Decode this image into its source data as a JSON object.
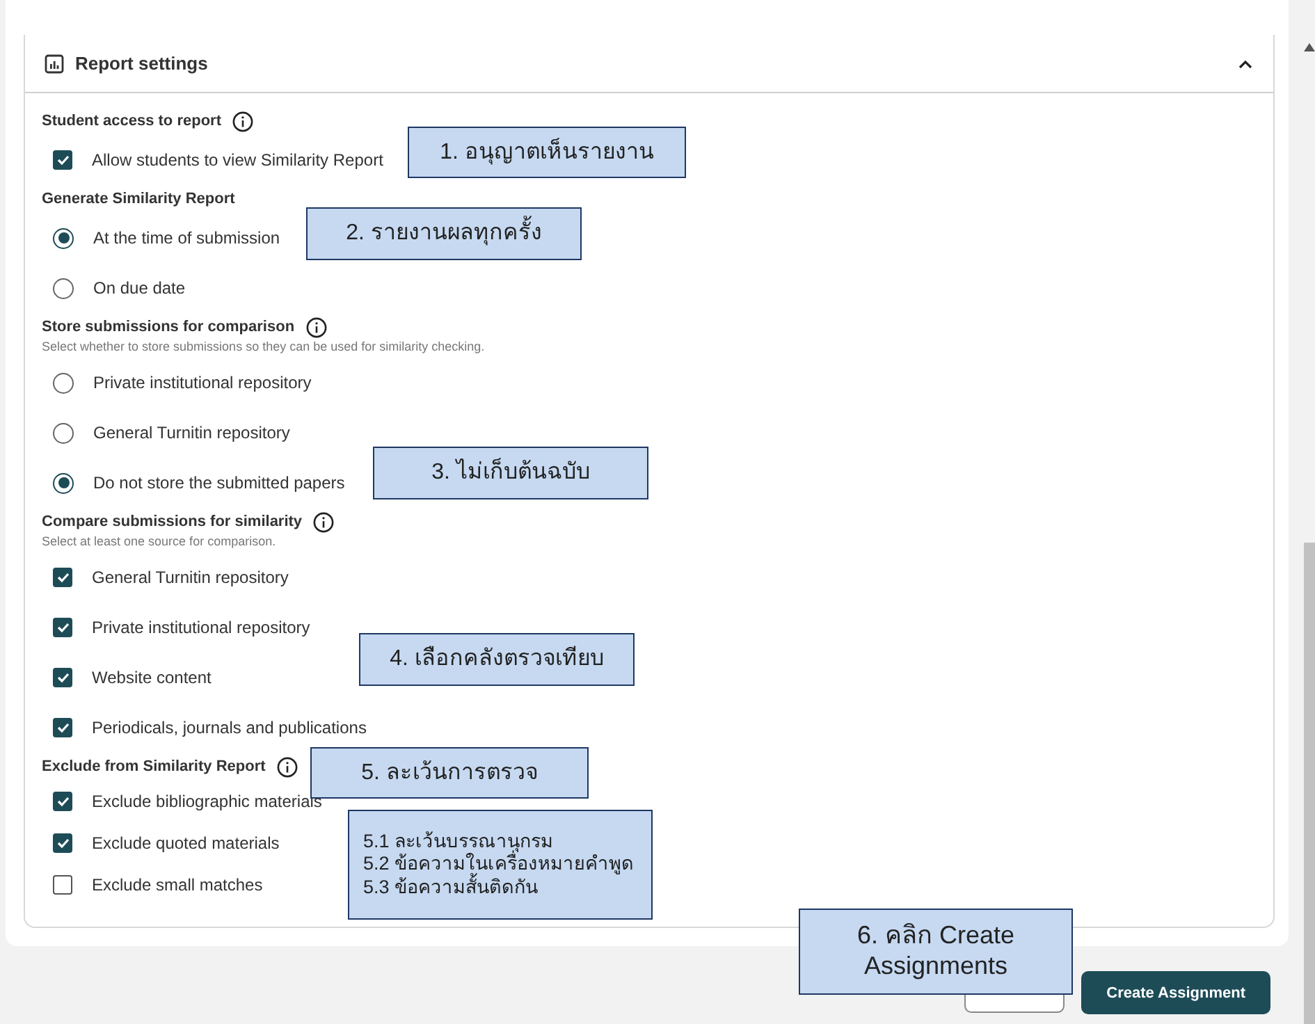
{
  "panel": {
    "title": "Report settings",
    "expanded": true
  },
  "sections": [
    {
      "title": "Student access to report",
      "info": true,
      "options": [
        {
          "kind": "checkbox",
          "label": "Allow students to view Similarity Report",
          "checked": true
        }
      ]
    },
    {
      "title": "Generate Similarity Report",
      "info": false,
      "options": [
        {
          "kind": "radio",
          "label": "At the time of submission",
          "selected": true
        },
        {
          "kind": "radio",
          "label": "On due date",
          "selected": false
        }
      ]
    },
    {
      "title": "Store submissions for comparison",
      "info": true,
      "hint": "Select whether to store submissions so they can be used for similarity checking.",
      "options": [
        {
          "kind": "radio",
          "label": "Private institutional repository",
          "selected": false
        },
        {
          "kind": "radio",
          "label": "General Turnitin repository",
          "selected": false
        },
        {
          "kind": "radio",
          "label": "Do not store the submitted papers",
          "selected": true
        }
      ]
    },
    {
      "title": "Compare submissions for similarity",
      "info": true,
      "hint": "Select at least one source for comparison.",
      "options": [
        {
          "kind": "checkbox",
          "label": "General Turnitin repository",
          "checked": true
        },
        {
          "kind": "checkbox",
          "label": "Private institutional repository",
          "checked": true
        },
        {
          "kind": "checkbox",
          "label": "Website content",
          "checked": true
        },
        {
          "kind": "checkbox",
          "label": "Periodicals, journals and publications",
          "checked": true
        }
      ]
    },
    {
      "title": "Exclude from Similarity Report",
      "info": true,
      "options": [
        {
          "kind": "checkbox",
          "label": "Exclude bibliographic materials",
          "checked": true
        },
        {
          "kind": "checkbox",
          "label": "Exclude quoted materials",
          "checked": true
        },
        {
          "kind": "checkbox",
          "label": "Exclude small matches",
          "checked": false
        }
      ]
    }
  ],
  "primary_button": "Create Assignment",
  "callouts": [
    {
      "lines": [
        "1. อนุญาตเห็นรายงาน"
      ]
    },
    {
      "lines": [
        "2. รายงานผลทุกครั้ง"
      ]
    },
    {
      "lines": [
        "3. ไม่เก็บต้นฉบับ"
      ]
    },
    {
      "lines": [
        "4. เลือกคลังตรวจเทียบ"
      ]
    },
    {
      "lines": [
        "5. ละเว้นการตรวจ"
      ]
    },
    {
      "lines": [
        "5.1 ละเว้นบรรณานุกรม",
        "5.2 ข้อความในเครื่องหมายคำพูด",
        "5.3 ข้อความสั้นติดกัน"
      ]
    },
    {
      "lines": [
        "6. คลิก Create",
        "Assignments"
      ]
    }
  ]
}
